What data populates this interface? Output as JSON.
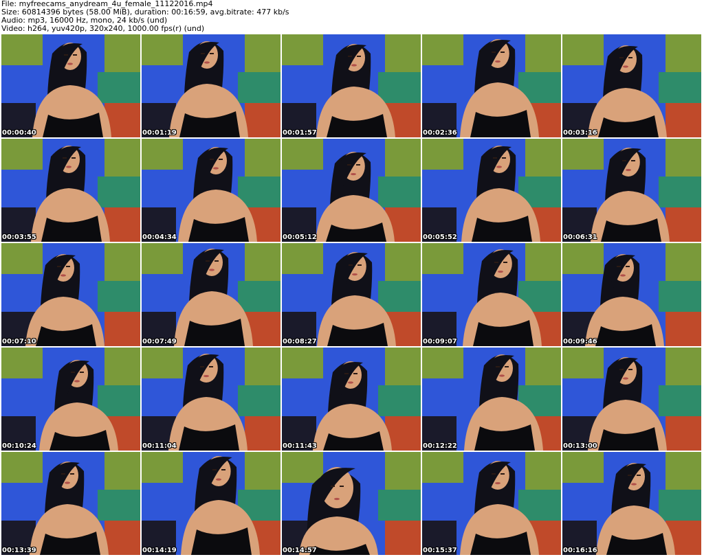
{
  "header": {
    "file_line": "File: myfreecams_anydream_4u_female_11122016.mp4",
    "size_line": "Size: 60814396 bytes (58.00 MiB), duration: 00:16:59, avg.bitrate: 477 kb/s",
    "audio_line": "Audio: mp3, 16000 Hz, mono, 24 kb/s (und)",
    "video_line": "Video: h264, yuv420p, 320x240, 1000.00 fps(r) (und)"
  },
  "colors": {
    "blue_panel": "#2f56d8",
    "green_panel": "#7a9a3a",
    "teal_panel": "#2e8c6a",
    "red_panel": "#c04a2a",
    "dark_panel": "#1a1a2a",
    "skin": "#d9a27a",
    "hair": "#101018",
    "top": "#0b0b0e"
  },
  "thumbnails": [
    {
      "timestamp": "00:00:40"
    },
    {
      "timestamp": "00:01:19"
    },
    {
      "timestamp": "00:01:57"
    },
    {
      "timestamp": "00:02:36"
    },
    {
      "timestamp": "00:03:16"
    },
    {
      "timestamp": "00:03:55"
    },
    {
      "timestamp": "00:04:34"
    },
    {
      "timestamp": "00:05:12"
    },
    {
      "timestamp": "00:05:52"
    },
    {
      "timestamp": "00:06:31"
    },
    {
      "timestamp": "00:07:10"
    },
    {
      "timestamp": "00:07:49"
    },
    {
      "timestamp": "00:08:27"
    },
    {
      "timestamp": "00:09:07"
    },
    {
      "timestamp": "00:09:46"
    },
    {
      "timestamp": "00:10:24"
    },
    {
      "timestamp": "00:11:04"
    },
    {
      "timestamp": "00:11:43"
    },
    {
      "timestamp": "00:12:22"
    },
    {
      "timestamp": "00:13:00"
    },
    {
      "timestamp": "00:13:39"
    },
    {
      "timestamp": "00:14:19"
    },
    {
      "timestamp": "00:14:57"
    },
    {
      "timestamp": "00:15:37"
    },
    {
      "timestamp": "00:16:16"
    }
  ]
}
